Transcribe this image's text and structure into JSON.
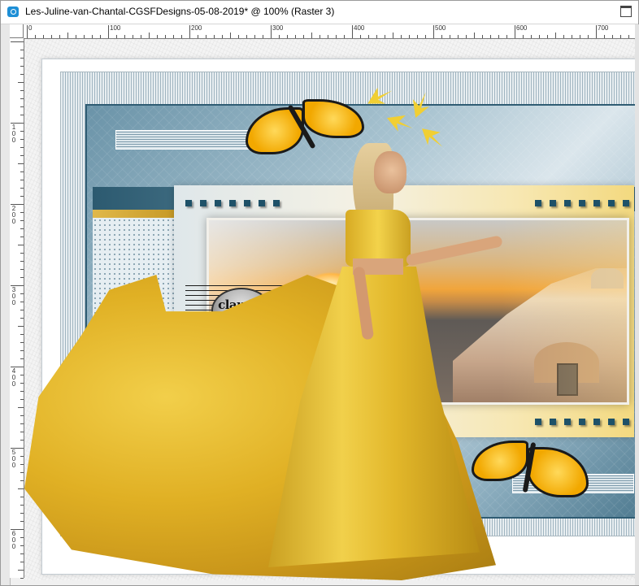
{
  "window": {
    "title": "Les-Juline-van-Chantal-CGSFDesigns-05-08-2019* @ 100% (Raster 3)"
  },
  "rulers": {
    "top_labels": [
      "0",
      "100",
      "200",
      "300",
      "400",
      "500",
      "600",
      "700"
    ],
    "left_labels": [
      "1 0 0",
      "2 0 0",
      "3 0 0",
      "4 0 0",
      "5 0 0",
      "6 0 0"
    ]
  },
  "canvas": {
    "watermark_text": "claudia"
  },
  "colors": {
    "accent_teal": "#2f5c73",
    "gown_gold": "#e0b024",
    "butterfly_orange": "#f2a800"
  }
}
